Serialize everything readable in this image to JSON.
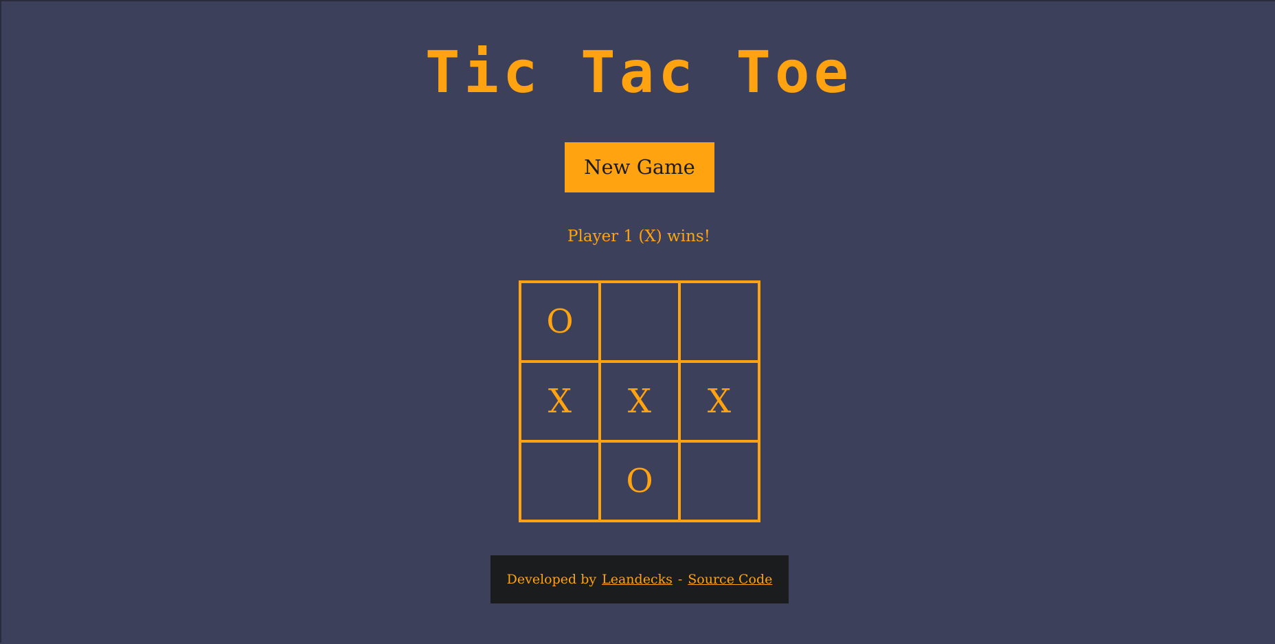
{
  "title": "Tic Tac Toe",
  "new_game_label": "New Game",
  "status": "Player 1 (X) wins!",
  "board": [
    "O",
    "",
    "",
    "X",
    "X",
    "X",
    "",
    "O",
    ""
  ],
  "footer": {
    "developed_by": "Developed by",
    "author_link": "Leandecks",
    "separator": "-",
    "source_link": "Source Code"
  },
  "colors": {
    "background": "#3d405b",
    "accent": "#ffa310",
    "footer_bg": "#1b1c1e",
    "button_text": "#1c1c1c"
  }
}
